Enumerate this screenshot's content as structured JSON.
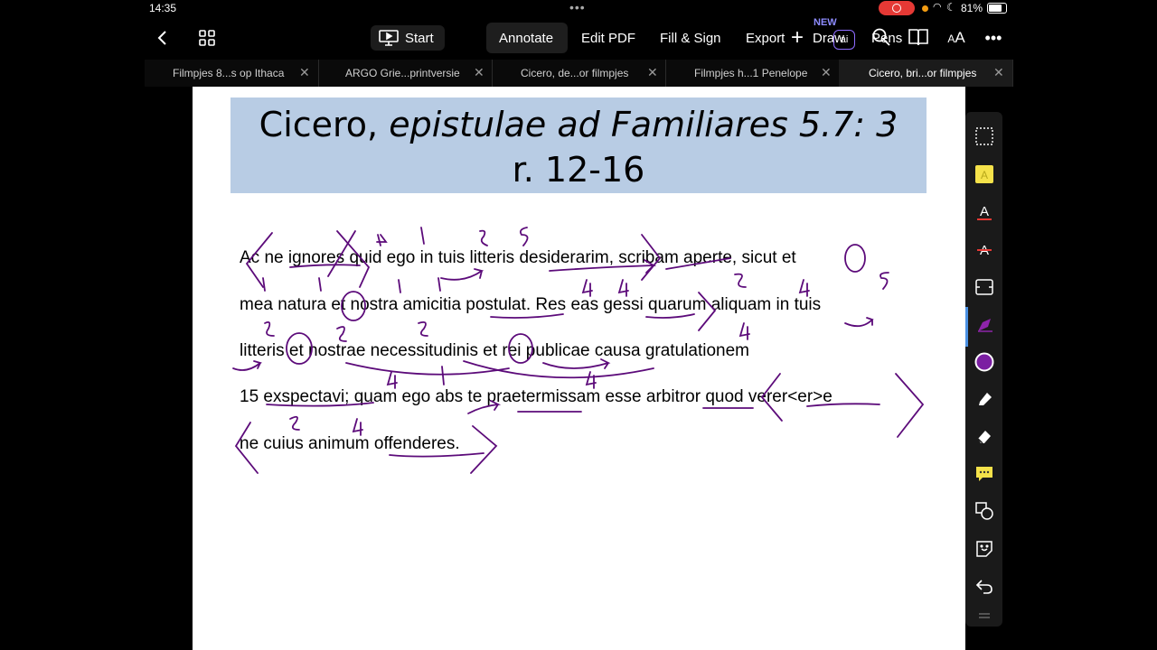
{
  "status": {
    "time": "14:35",
    "battery": "81%"
  },
  "toolbar": {
    "start_label": "Start",
    "menu": [
      "Annotate",
      "Edit PDF",
      "Fill & Sign",
      "Export",
      "Draw",
      "Pens"
    ],
    "active_menu": "Annotate",
    "new_badge": "NEW",
    "ai_label": "ai"
  },
  "tabs": [
    {
      "label": "Filmpjes 8...s op Ithaca"
    },
    {
      "label": "ARGO Grie...printversie"
    },
    {
      "label": "Cicero, de...or filmpjes"
    },
    {
      "label": "Filmpjes h...1 Penelope"
    },
    {
      "label": "Cicero, bri...or filmpjes",
      "active": true
    }
  ],
  "document": {
    "title_plain": "Cicero, ",
    "title_italic": "epistulae ad Familiares 5.7: 3",
    "title_line2": "r. 12-16",
    "lines": [
      "Ac ne ignores quid ego in tuis litteris desiderarim, scribam aperte, sicut et",
      "mea natura et nostra amicitia postulat. Res eas gessi quarum aliquam in tuis",
      "litteris et nostrae necessitudinis et rei publicae causa gratulationem",
      "15 exspectavi; quam ego abs te praetermissam esse arbitror quod verer<er>e",
      "ne cuius animum offenderes."
    ]
  },
  "ink_color": "#5c0b7a",
  "right_tools": [
    "select-icon",
    "highlight-icon",
    "text-underline-icon",
    "text-strikethrough-icon",
    "textbox-icon",
    "pen-icon",
    "color-icon",
    "marker-icon",
    "eraser-icon",
    "comment-icon",
    "shapes-icon",
    "sticker-icon",
    "undo-icon",
    "handle-icon"
  ]
}
